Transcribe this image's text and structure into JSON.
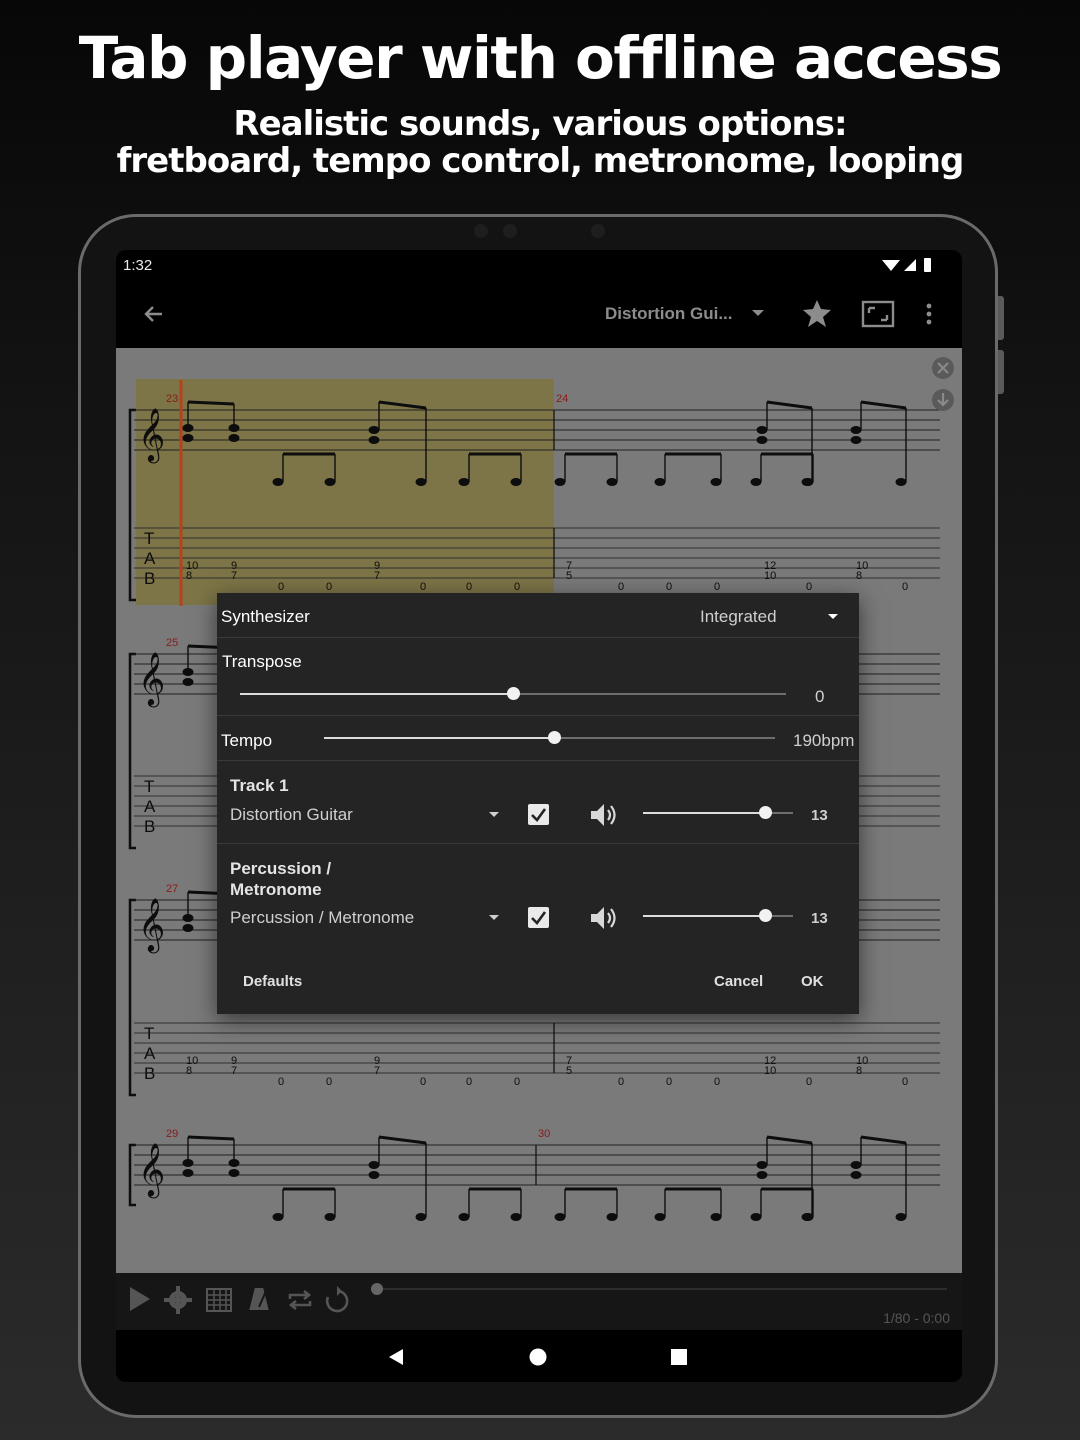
{
  "headline": "Tab player with offline access",
  "subline1": "Realistic sounds, various options:",
  "subline2": "fretboard, tempo control, metronome, looping",
  "status": {
    "time": "1:32"
  },
  "appbar": {
    "title": "Distortion Gui..."
  },
  "score": {
    "systems": [
      {
        "top_measure": "23",
        "second_measure": "24",
        "tab_row1": [
          "10",
          "9",
          "9",
          "7",
          "12",
          "10"
        ],
        "tab_row2": [
          "8",
          "7",
          "7",
          "5",
          "10",
          "8"
        ]
      },
      {
        "top_measure": "25"
      },
      {
        "top_measure": "27",
        "tab_row1": [
          "10",
          "9",
          "9",
          "7",
          "12",
          "10"
        ],
        "tab_row2": [
          "8",
          "7",
          "7",
          "5",
          "10",
          "8"
        ]
      },
      {
        "top_measure": "29",
        "second_measure": "30"
      }
    ],
    "tab_letters": [
      "T",
      "A",
      "B"
    ],
    "open_fret": "0"
  },
  "dialog": {
    "synth_label": "Synthesizer",
    "synth_value": "Integrated",
    "transpose_label": "Transpose",
    "transpose_value": "0",
    "transpose_fraction": 0.5,
    "tempo_label": "Tempo",
    "tempo_value": "190bpm",
    "tempo_fraction": 0.51,
    "tracks": [
      {
        "name": "Track 1",
        "instrument": "Distortion Guitar",
        "volume": "13",
        "volume_fraction": 0.81
      },
      {
        "name": "Percussion / Metronome",
        "instrument": "Percussion / Metronome",
        "volume": "13",
        "volume_fraction": 0.81
      }
    ],
    "defaults_label": "Defaults",
    "cancel_label": "Cancel",
    "ok_label": "OK"
  },
  "player": {
    "position": "1/80 - 0:00",
    "progress_fraction": 0.0
  }
}
